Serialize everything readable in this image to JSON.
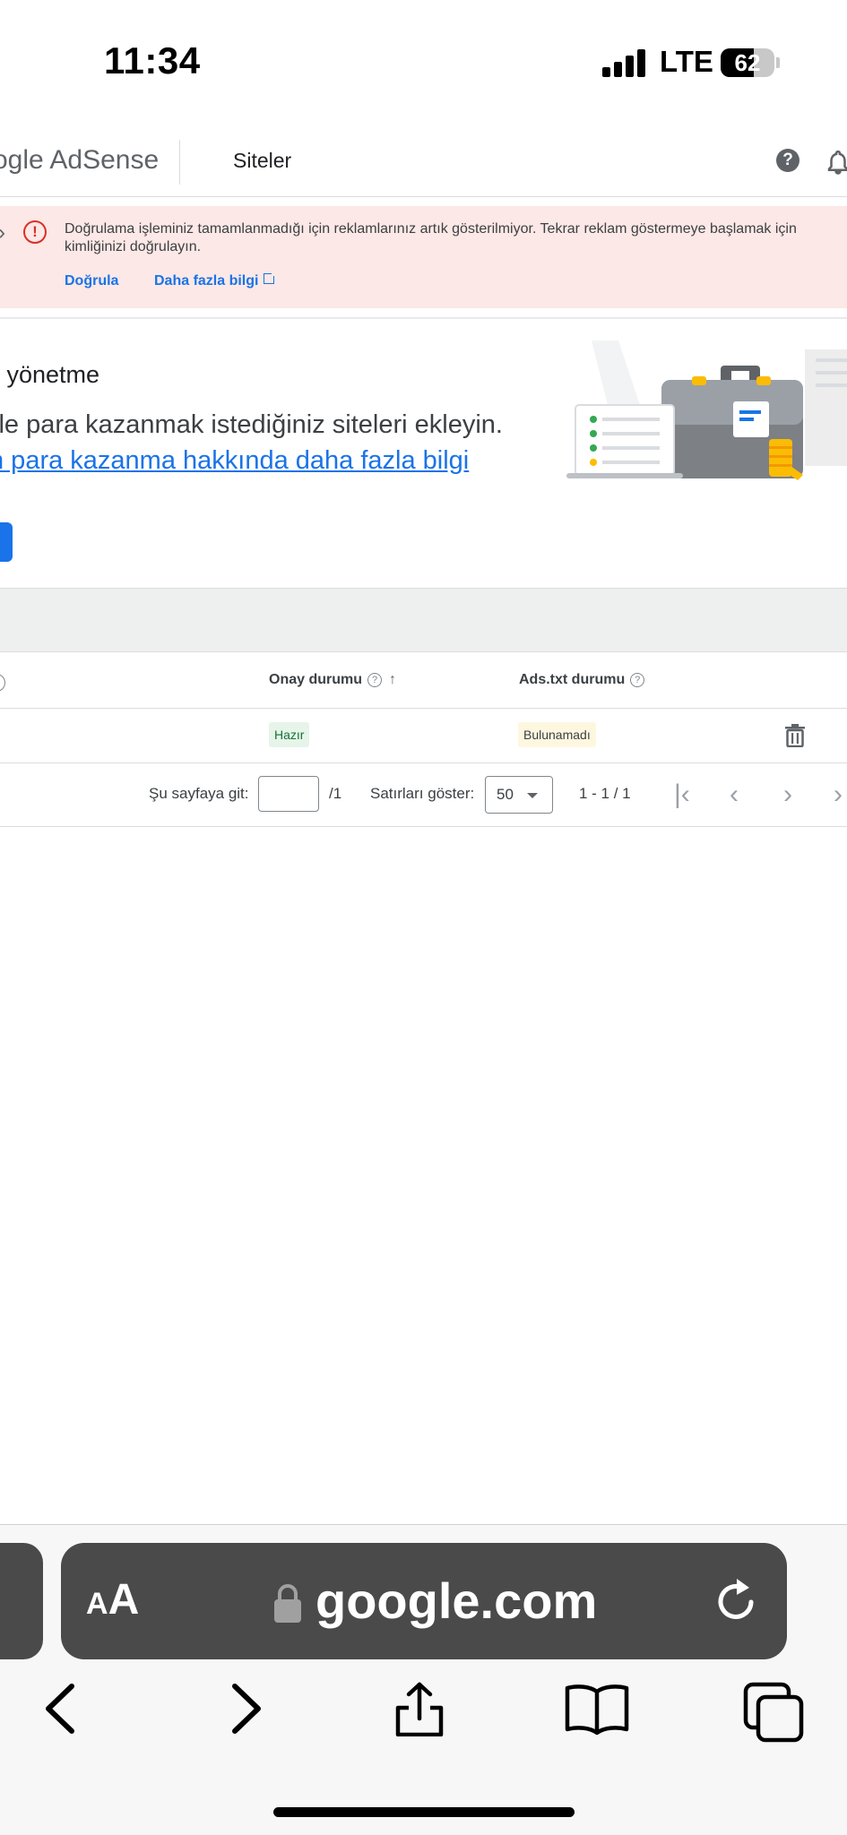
{
  "status_bar": {
    "time": "11:34",
    "network": "LTE",
    "battery": "62",
    "battery_level": 0.62
  },
  "header": {
    "brand": "ogle AdSense",
    "page_title": "Siteler",
    "icons": [
      "help-icon",
      "bell-icon"
    ]
  },
  "alert": {
    "message": "Doğrulama işleminiz tamamlanmadığı için reklamlarınız artık gösterilmiyor. Tekrar reklam göstermeye başlamak için kimliğinizi doğrulayın.",
    "verify_label": "Doğrula",
    "learn_more_label": "Daha fazla bilgi",
    "color": "#d93025"
  },
  "intro": {
    "title": "i yönetme",
    "description": "ile para kazanmak istediğiniz siteleri ekleyin.",
    "link": "n para kazanma hakkında daha fazla bilgi"
  },
  "table": {
    "columns": [
      {
        "label": "Onay durumu",
        "sorted": "ascending"
      },
      {
        "label": "Ads.txt durumu"
      }
    ],
    "rows": [
      {
        "approval": "Hazır",
        "ads_txt": "Bulunamadı"
      }
    ]
  },
  "pagination": {
    "goto_label": "Şu sayfaya git:",
    "page_input": "",
    "total_pages": "/1",
    "rows_label": "Satırları göster:",
    "rows_value": "50",
    "range": "1 - 1 / 1"
  },
  "browser": {
    "text_size_label_small": "A",
    "text_size_label_big": "A",
    "url": "google.com"
  },
  "colors": {
    "accent": "#1a73e8",
    "alert_bg": "#fce8e6",
    "ready_chip": "#e6f4ea",
    "warning_chip": "#fef7e0"
  }
}
